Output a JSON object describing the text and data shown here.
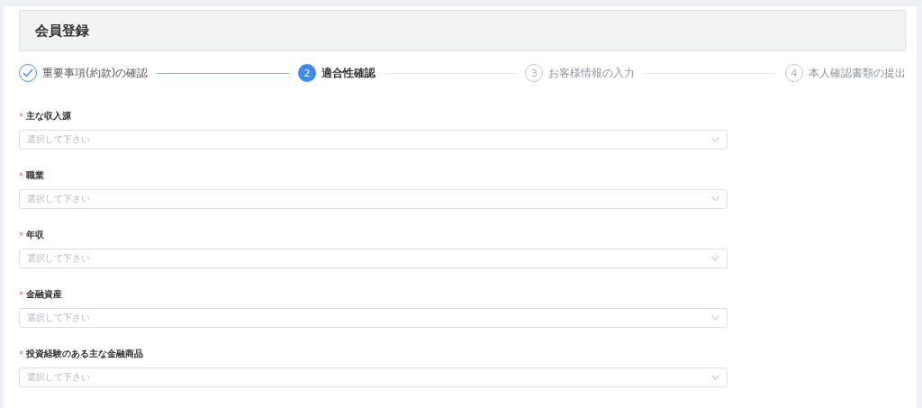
{
  "header": {
    "title": "会員登録"
  },
  "steps": [
    {
      "label": "重要事項(約款)の確認",
      "completed": true,
      "selected": false
    },
    {
      "number": "2",
      "label": "適合性確認",
      "completed": false,
      "selected": true
    },
    {
      "number": "3",
      "label": "お客様情報の入力",
      "completed": false,
      "selected": false
    },
    {
      "number": "4",
      "label": "本人確認書類の提出",
      "completed": false,
      "selected": false
    }
  ],
  "fields": [
    {
      "mark": "*",
      "label": "主な収入源",
      "placeholder": "選択して下さい"
    },
    {
      "mark": "*",
      "label": "職業",
      "placeholder": "選択して下さい"
    },
    {
      "mark": "*",
      "label": "年収",
      "placeholder": "選択して下さい"
    },
    {
      "mark": "*",
      "label": "金融資産",
      "placeholder": "選択して下さい"
    },
    {
      "mark": "*",
      "label": "投資経験のある主な金融商品",
      "placeholder": "選択して下さい"
    }
  ]
}
